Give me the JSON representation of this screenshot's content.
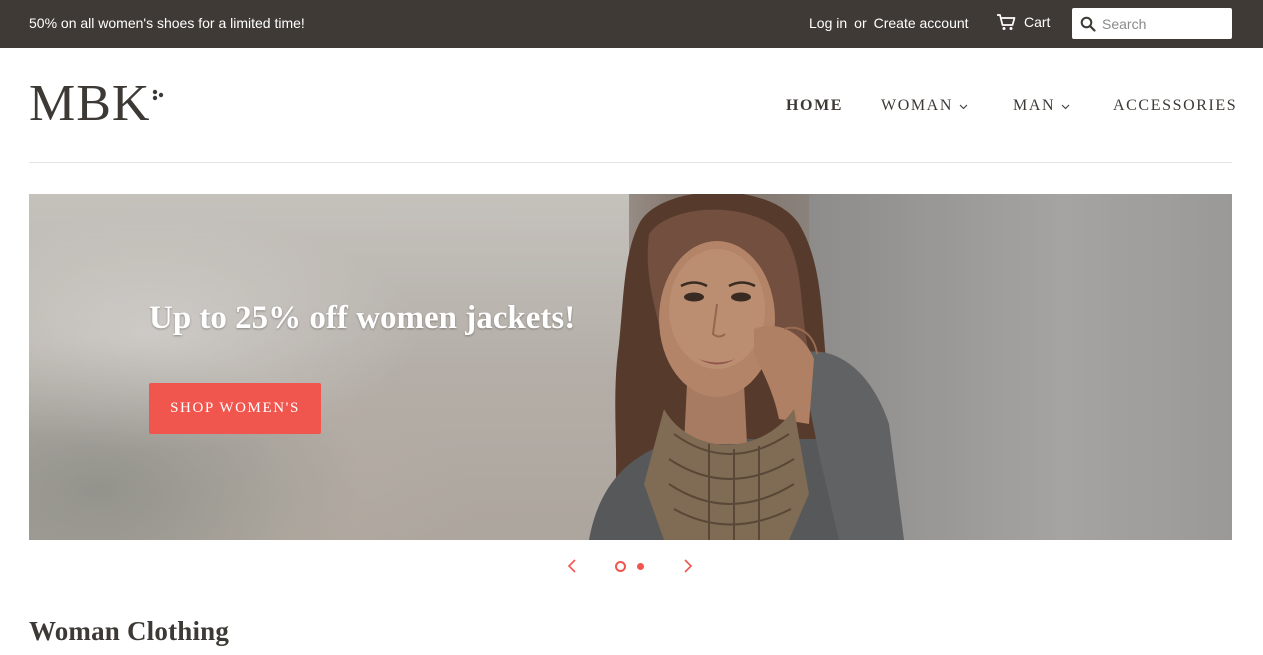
{
  "announcement": {
    "text": "50% on all women's shoes for a limited time!"
  },
  "account": {
    "login_label": "Log in",
    "or_label": "or",
    "create_label": "Create account",
    "cart_label": "Cart"
  },
  "search": {
    "placeholder": "Search"
  },
  "logo": {
    "text": "MBK"
  },
  "nav": {
    "items": [
      {
        "label": "HOME",
        "has_dropdown": false,
        "active": true
      },
      {
        "label": "WOMAN",
        "has_dropdown": true,
        "active": false
      },
      {
        "label": "MAN",
        "has_dropdown": true,
        "active": false
      },
      {
        "label": "ACCESSORIES",
        "has_dropdown": false,
        "active": false
      }
    ]
  },
  "hero": {
    "headline": "Up to 25% off women jackets!",
    "cta_label": "SHOP WOMEN'S",
    "image_icon": "woman-portrait-image"
  },
  "slider": {
    "prev_icon": "chevron-left-icon",
    "next_icon": "chevron-right-icon",
    "slide_count": 2,
    "current_slide": 1
  },
  "section": {
    "title": "Woman Clothing"
  },
  "colors": {
    "topbar_bg": "#403a36",
    "accent": "#f0564d",
    "text": "#3d3935"
  }
}
